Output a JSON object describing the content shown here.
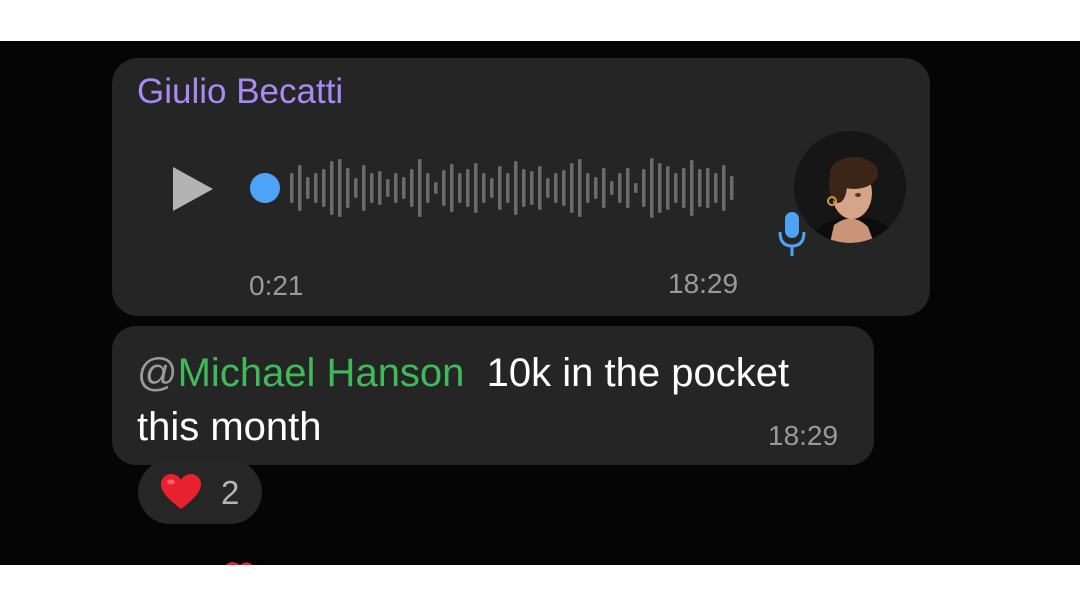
{
  "voice_message": {
    "sender": "Giulio Becatti",
    "duration": "0:21",
    "time": "18:29",
    "colors": {
      "sender": "#a78bf4",
      "progress_dot": "#4fa3f7",
      "waveform": "#6b6b6b",
      "mic": "#4fa3f7"
    },
    "icons": {
      "play": "play-icon",
      "mic": "microphone-icon"
    }
  },
  "text_message": {
    "at_symbol": "@",
    "mention": "Michael Hanson",
    "body": "10k in the pocket this month",
    "time": "18:29",
    "colors": {
      "mention": "#3fb95a"
    }
  },
  "reaction": {
    "emoji": "❤️",
    "count": "2"
  }
}
